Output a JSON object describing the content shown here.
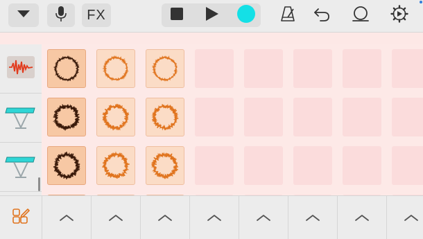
{
  "toolbar": {
    "menu_icon": "chevron-down-icon",
    "mic_icon": "microphone-icon",
    "fx_label": "FX",
    "stop_icon": "stop-icon",
    "play_icon": "play-icon",
    "record_icon": "record-icon",
    "metronome_icon": "metronome-icon",
    "undo_icon": "undo-icon",
    "loop_icon": "loop-icon",
    "settings_icon": "gear-icon"
  },
  "colors": {
    "record": "#14e0e6",
    "selected_cell": "#f7c8a4",
    "filled_cell": "#fbdcc6",
    "empty_cell": "#fbdcdc",
    "waveform_dark": "#3a1a0a",
    "waveform_orange": "#e0741e"
  },
  "tracks": [
    {
      "name": "track-1",
      "icon": "waveform-icon"
    },
    {
      "name": "track-2",
      "icon": "keyboard-icon"
    },
    {
      "name": "track-3",
      "icon": "keyboard-icon"
    }
  ],
  "grid": {
    "rows": [
      [
        "sel",
        "full",
        "full",
        "empty",
        "empty",
        "empty",
        "empty",
        "empty"
      ],
      [
        "sel",
        "full",
        "full",
        "empty",
        "empty",
        "empty",
        "empty",
        "empty"
      ],
      [
        "sel",
        "full",
        "full",
        "empty",
        "empty",
        "empty",
        "empty",
        "empty"
      ]
    ]
  },
  "bottom": {
    "edit_icon": "edit-grid-icon",
    "column_icon": "chevron-up-icon"
  }
}
